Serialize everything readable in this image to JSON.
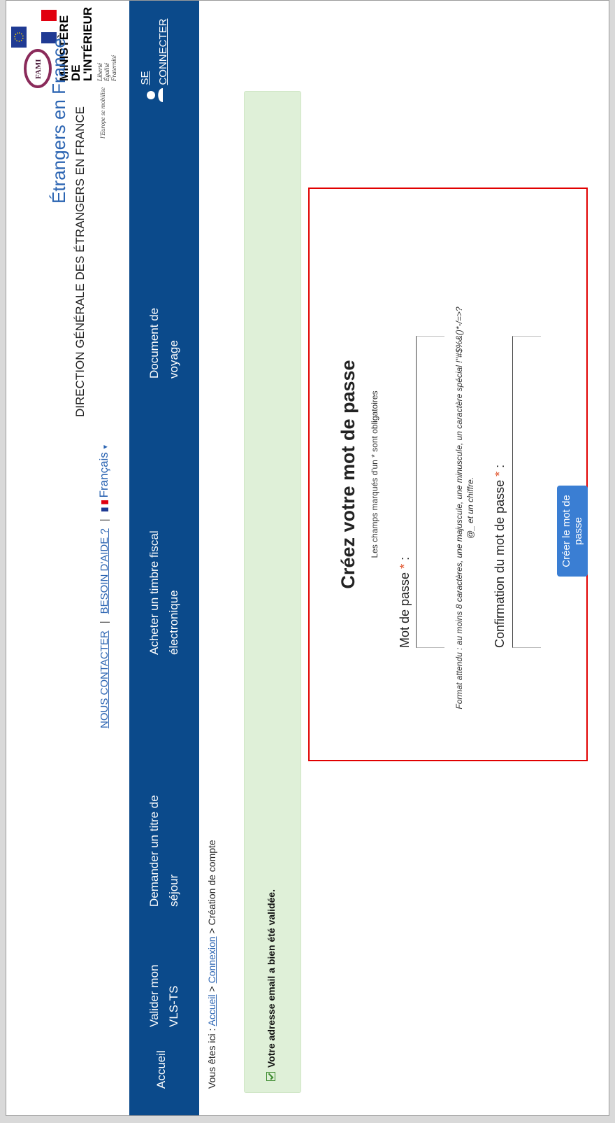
{
  "header": {
    "ministry_line1": "MINISTÈRE",
    "ministry_line2": "DE L'INTÉRIEUR",
    "motto": [
      "Liberté",
      "Égalité",
      "Fraternité"
    ],
    "site_title": "Étrangers en France",
    "site_subtitle": "DIRECTION GÉNÉRALE DES ÉTRANGERS EN FRANCE",
    "fami_name": "FAMI",
    "fami_tagline": "l'Europe se mobilise",
    "links": {
      "contact": "NOUS CONTACTER",
      "help": "BESOIN D'AIDE ?",
      "language": "Français"
    }
  },
  "nav": {
    "items": [
      "Accueil",
      "Valider mon VLS-TS",
      "Demander un titre de séjour",
      "Acheter un timbre fiscal électronique",
      "Document de voyage"
    ],
    "login": "SE CONNECTER"
  },
  "breadcrumb": {
    "prefix": "Vous êtes ici :",
    "home": "Accueil",
    "login": "Connexion",
    "current": "Création de compte",
    "separator": ">"
  },
  "alert": {
    "message": "Votre adresse email a bien été validée."
  },
  "form": {
    "title": "Créez votre mot de passe",
    "required_note": "Les champs marqués d'un * sont obligatoires",
    "password_label": "Mot de passe",
    "password_hint": "Format attendu : au moins 8 caractères, une majuscule, une minuscule, un caractère spécial !\"#$%&()*-/=>?@_ et un chiffre.",
    "confirm_label": "Confirmation du mot de passe",
    "required_mark": "*",
    "label_suffix": ":",
    "submit": "Créer le mot de passe"
  },
  "colors": {
    "navbar": "#0b4a8b",
    "link": "#2b64b2",
    "button": "#3a7ed3",
    "alert_bg": "#dff0d8",
    "highlight_border": "#e10000"
  }
}
